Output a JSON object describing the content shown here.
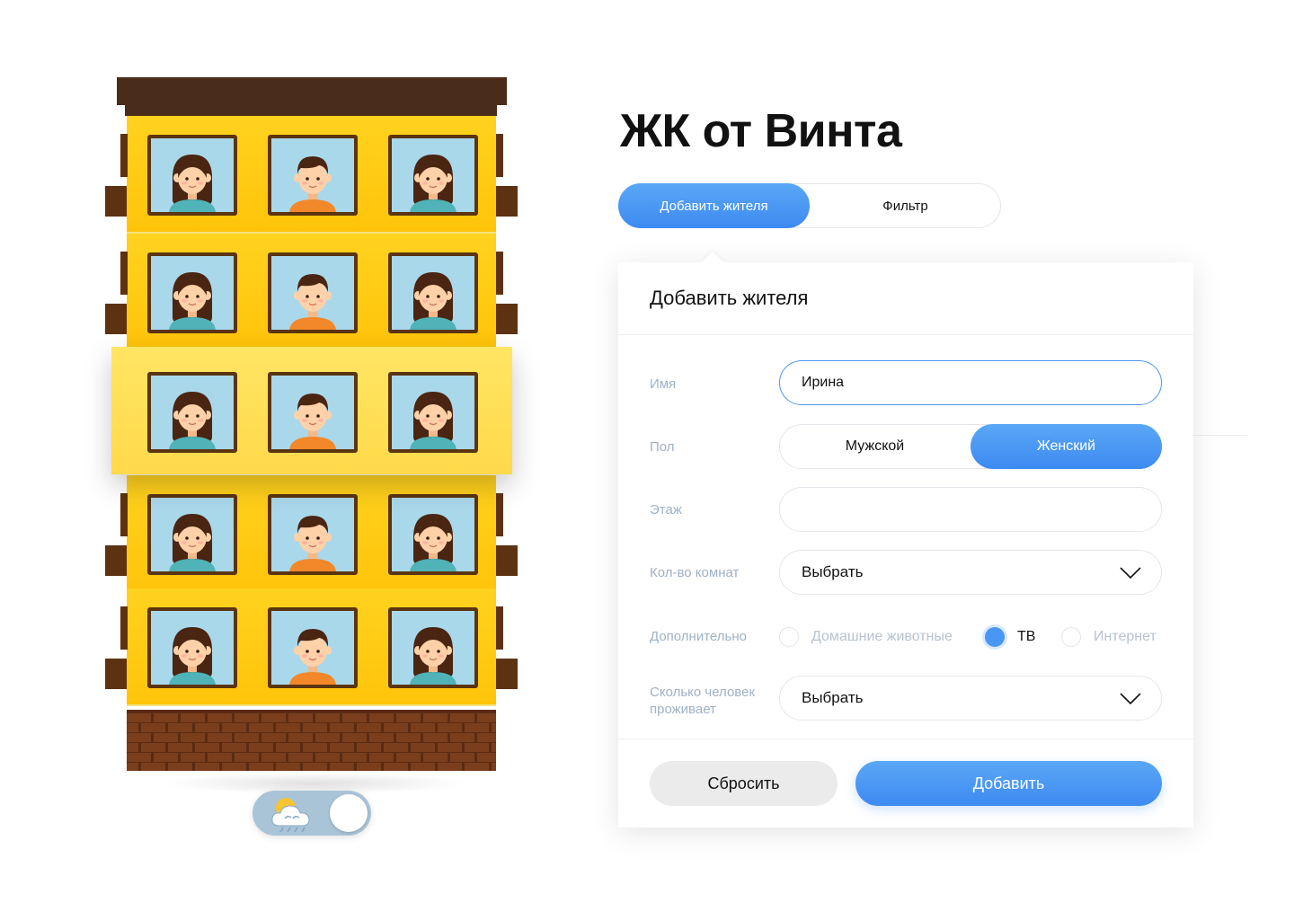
{
  "title": "ЖК от Винта",
  "tabs": {
    "add": "Добавить жителя",
    "filter": "Фильтр",
    "active": "add"
  },
  "panel": {
    "title": "Добавить жителя",
    "name": {
      "label": "Имя",
      "value": "Ирина"
    },
    "gender": {
      "label": "Пол",
      "male": "Мужской",
      "female": "Женский",
      "selected": "female"
    },
    "floor": {
      "label": "Этаж",
      "value": ""
    },
    "rooms": {
      "label": "Кол-во комнат",
      "value": "Выбрать"
    },
    "extra": {
      "label": "Дополнительно",
      "options": [
        {
          "label": "Домашние животные",
          "checked": false
        },
        {
          "label": "ТВ",
          "checked": true
        },
        {
          "label": "Интернет",
          "checked": false
        }
      ]
    },
    "people": {
      "label": "Сколько человек проживает",
      "value": "Выбрать"
    },
    "reset": "Сбросить",
    "submit": "Добавить"
  },
  "building": {
    "floors": 5,
    "windows_per_floor": 3,
    "residents_pattern": [
      "girl",
      "boy",
      "girl"
    ],
    "highlighted_floor": 3
  },
  "weather_toggle": {
    "icon": "sun-cloud-rain-icon",
    "state": "on"
  },
  "colors": {
    "accent": "#3d8af2",
    "building_wall": "#ffcb12",
    "building_highlight": "#ffe058",
    "roof": "#4a2c1a",
    "window_frame": "#5b3410",
    "window_glass": "#a9d8ea",
    "label": "#9fb1c6"
  }
}
